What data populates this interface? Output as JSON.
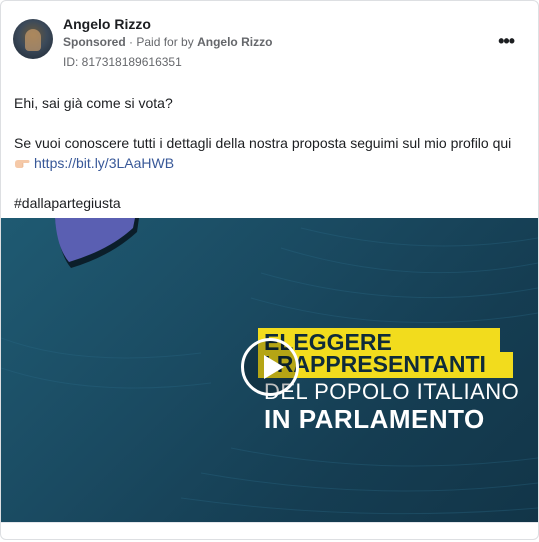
{
  "post": {
    "author": "Angelo Rizzo",
    "sponsored_label": "Sponsored",
    "paid_for_prefix": "Paid for by",
    "payer": "Angelo Rizzo",
    "ad_id": "ID: 817318189616351",
    "more_icon": "more-options-icon"
  },
  "body": {
    "line1": "Ehi, sai già come si vota?",
    "line2": "Se vuoi conoscere tutti i dettagli della nostra proposta seguimi sul mio profilo qui",
    "link": "https://bit.ly/3LAaHWB",
    "hashtag": "#dallapartegiusta"
  },
  "video": {
    "line1": "ELEGGERE",
    "line2": "I RAPPRESENTANTI",
    "line3": "DEL POPOLO ITALIANO",
    "line4": "IN PARLAMENTO",
    "highlight_color": "#f2dc1d",
    "background_color": "#1a4a61"
  }
}
